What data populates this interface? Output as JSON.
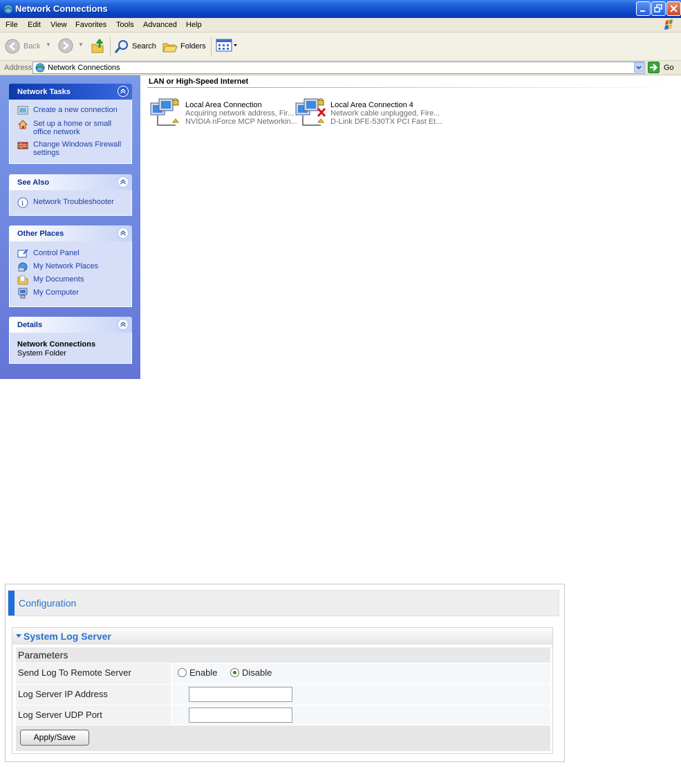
{
  "window": {
    "title": "Network Connections",
    "menu": [
      "File",
      "Edit",
      "View",
      "Favorites",
      "Tools",
      "Advanced",
      "Help"
    ],
    "toolbar": {
      "back": "Back",
      "search": "Search",
      "folders": "Folders"
    },
    "address": {
      "label": "Address",
      "value": "Network Connections",
      "go": "Go"
    }
  },
  "taskpane": {
    "network_tasks": {
      "title": "Network Tasks",
      "items": [
        "Create a new connection",
        "Set up a home or small office network",
        "Change Windows Firewall settings"
      ]
    },
    "see_also": {
      "title": "See Also",
      "items": [
        "Network Troubleshooter"
      ]
    },
    "other_places": {
      "title": "Other Places",
      "items": [
        "Control Panel",
        "My Network Places",
        "My Documents",
        "My Computer"
      ]
    },
    "details": {
      "title": "Details",
      "name": "Network Connections",
      "type": "System Folder"
    }
  },
  "content": {
    "group": "LAN or High-Speed Internet",
    "connections": [
      {
        "name": "Local Area Connection",
        "status": "Acquiring network address, Fir...",
        "device": "NVIDIA nForce MCP Networkin...",
        "unplugged": false
      },
      {
        "name": "Local Area Connection 4",
        "status": "Network cable unplugged, Fire...",
        "device": "D-Link DFE-530TX PCI Fast Et...",
        "unplugged": true
      }
    ]
  },
  "router": {
    "header": "Configuration",
    "section": "System Log Server",
    "params": "Parameters",
    "send_log_label": "Send Log To Remote Server",
    "enable": "Enable",
    "disable": "Disable",
    "selected": "Disable",
    "ip_label": "Log Server IP Address",
    "ip_value": "",
    "port_label": "Log Server UDP Port",
    "port_value": "",
    "apply": "Apply/Save"
  }
}
